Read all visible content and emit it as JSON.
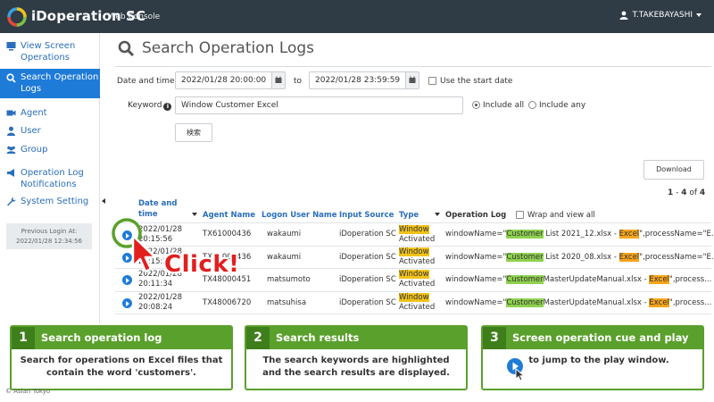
{
  "app": {
    "name": "iDoperation SC",
    "subtitle": "Web Console",
    "user": "T.TAKEBAYASHI"
  },
  "sidebar": {
    "items": [
      {
        "label": "View Screen Operations",
        "icon": "monitor-icon"
      },
      {
        "label": "Search Operation Logs",
        "icon": "search-icon",
        "active": true
      },
      {
        "label": "Agent",
        "icon": "camera-icon"
      },
      {
        "label": "User",
        "icon": "user-icon"
      },
      {
        "label": "Group",
        "icon": "group-icon"
      },
      {
        "label": "Operation Log Notifications",
        "icon": "megaphone-icon"
      },
      {
        "label": "System Setting",
        "icon": "wrench-icon"
      }
    ],
    "previous_login_label": "Previous Login At:",
    "previous_login_value": "2022/01/28 12:34:56"
  },
  "main": {
    "title": "Search Operation Logs",
    "form": {
      "date_label": "Date and time",
      "date_from": "2022/01/28 20:00:00",
      "date_to_label": "to",
      "date_to": "2022/01/28 23:59:59",
      "use_start_date": "Use the start date",
      "keyword_label": "Keyword",
      "keyword_value": "Window Customer Excel",
      "include_all": "Include all",
      "include_any": "Include any",
      "search_button": "検索"
    },
    "download_button": "Download",
    "pagination": {
      "from": "1",
      "sep": " - ",
      "to": "4",
      "of": " of ",
      "total": "4"
    },
    "table": {
      "headers": {
        "date": "Date and time",
        "agent": "Agent Name",
        "logon": "Logon User Name",
        "input": "Input Source",
        "type": "Type",
        "oplog": "Operation Log",
        "wrap": "Wrap and view all"
      },
      "rows": [
        {
          "date1": "2022/01/28",
          "date2": "20:15:56",
          "agent": "TX61000436",
          "user": "wakaumi",
          "input": "iDoperation SC",
          "type1": "Window",
          "type2": "Activated",
          "log_pre": "windowName=\"",
          "log_hl1": "Customer",
          "log_mid": " List 2021_12.xlsx - ",
          "log_hl2": "Excel",
          "log_post": "\",processName=\"E..."
        },
        {
          "date1": "2022/01/28",
          "date2": "20:15:29",
          "agent": "TX61000436",
          "user": "wakaumi",
          "input": "iDoperation SC",
          "type1": "Window",
          "type2": "Activated",
          "log_pre": "windowName=\"",
          "log_hl1": "Customer",
          "log_mid": " List 2020_08.xlsx - ",
          "log_hl2": "Excel",
          "log_post": "\",processName=\"E..."
        },
        {
          "date1": "2022/01/28",
          "date2": "20:11:34",
          "agent": "TX48000451",
          "user": "matsumoto",
          "input": "iDoperation SC",
          "type1": "Window",
          "type2": "Activated",
          "log_pre": "windowName=\"",
          "log_hl1": "Customer",
          "log_mid": "MasterUpdateManual.xlsx - ",
          "log_hl2": "Excel",
          "log_post": "\",process..."
        },
        {
          "date1": "2022/01/28",
          "date2": "20:08:24",
          "agent": "TX48006720",
          "user": "matsuhisa",
          "input": "iDoperation SC",
          "type1": "Window",
          "type2": "Activated",
          "log_pre": "windowName=\"",
          "log_hl1": "Customer",
          "log_mid": "MasterUpdateManual.xlsx - ",
          "log_hl2": "Excel",
          "log_post": "\",process..."
        }
      ]
    }
  },
  "callout": {
    "click_label": "Click!"
  },
  "steps": [
    {
      "num": "1",
      "title": "Search operation log",
      "body1": "Search for operations on Excel files that",
      "body2": "contain the word 'customers'."
    },
    {
      "num": "2",
      "title": "Search results",
      "body1": "The search keywords are highlighted",
      "body2": "and the search results are displayed."
    },
    {
      "num": "3",
      "title": "Screen operation cue and play",
      "body1": "to jump to the play window."
    }
  ],
  "footer": {
    "copyright": "Asian Tokyo"
  },
  "colors": {
    "accent": "#1f7bd8",
    "topbar": "#2f3b45",
    "step_green": "#5aa02c",
    "highlight_green": "#8fd14f",
    "highlight_orange": "#f7a51c",
    "click_red": "#e11f1f"
  }
}
